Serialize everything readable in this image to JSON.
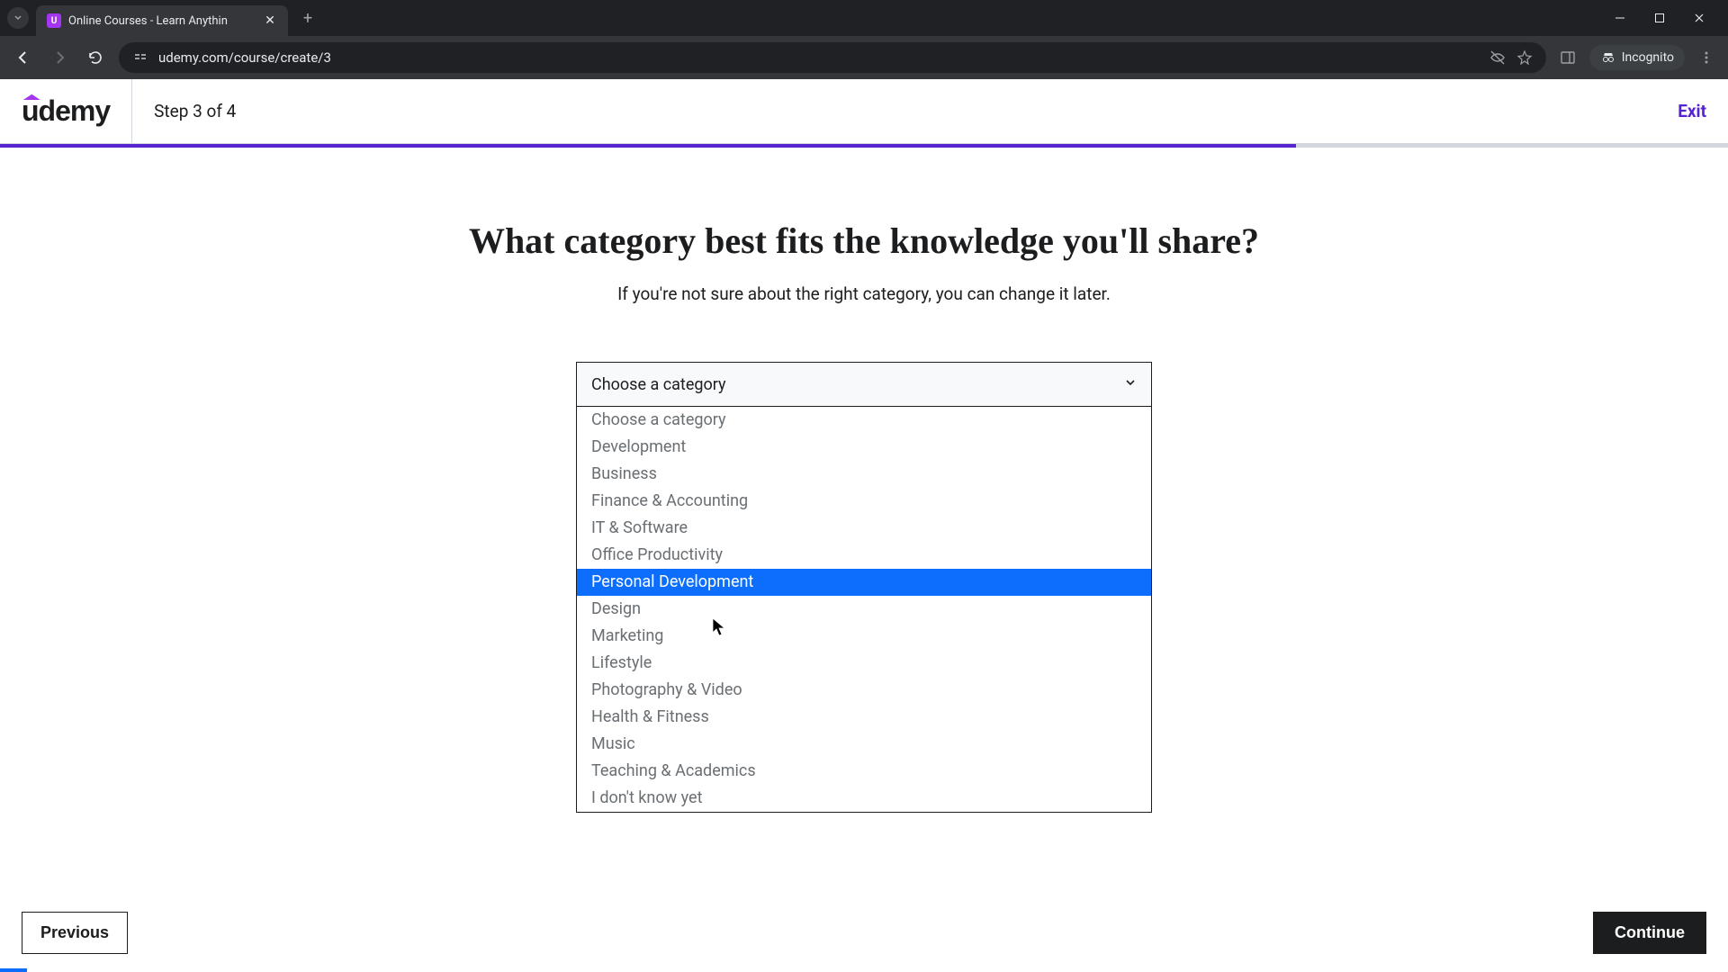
{
  "browser": {
    "tab_title": "Online Courses - Learn Anythin",
    "url": "udemy.com/course/create/3",
    "incognito_label": "Incognito"
  },
  "header": {
    "logo_text": "ûdemy",
    "step_text": "Step 3 of 4",
    "exit_text": "Exit"
  },
  "progress": {
    "percent": 75
  },
  "content": {
    "title": "What category best fits the knowledge you'll share?",
    "subtitle": "If you're not sure about the right category, you can change it later."
  },
  "select": {
    "placeholder": "Choose a category",
    "options": [
      "Choose a category",
      "Development",
      "Business",
      "Finance & Accounting",
      "IT & Software",
      "Office Productivity",
      "Personal Development",
      "Design",
      "Marketing",
      "Lifestyle",
      "Photography & Video",
      "Health & Fitness",
      "Music",
      "Teaching & Academics",
      "I don't know yet"
    ],
    "highlighted_index": 6
  },
  "footer": {
    "previous_label": "Previous",
    "continue_label": "Continue"
  },
  "colors": {
    "accent": "#5624d0",
    "brand": "#a435f0",
    "highlight": "#0d6efd"
  }
}
